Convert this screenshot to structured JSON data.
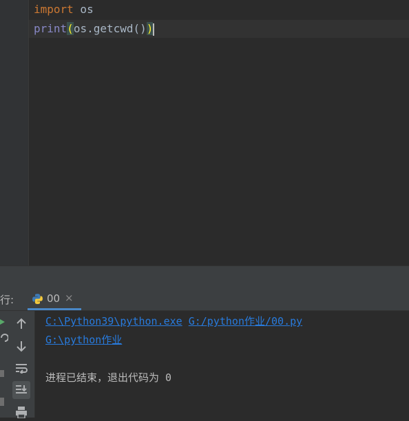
{
  "editor": {
    "line1": {
      "keyword": "import",
      "rest": " os"
    },
    "line2": {
      "func": "print",
      "open_paren": "(",
      "args": "os.getcwd()",
      "close_paren": ")"
    }
  },
  "run_panel": {
    "label": "行:",
    "tab": {
      "icon": "python-icon",
      "label": "00",
      "close": "×"
    },
    "toolbar": [
      "arrow-up-icon",
      "arrow-down-icon",
      "soft-wrap-icon",
      "scroll-to-end-icon",
      "print-icon"
    ],
    "console": {
      "line1_part1": "C:\\Python39\\python.exe",
      "line1_part2": "G:/python作业/00.py",
      "line2": "G:\\python作业",
      "exit_message": "进程已结束，退出代码为 0"
    }
  },
  "colors": {
    "link": "#287bde",
    "keyword": "#cc7832",
    "builtin": "#8888c6",
    "accent": "#4a88c7"
  }
}
